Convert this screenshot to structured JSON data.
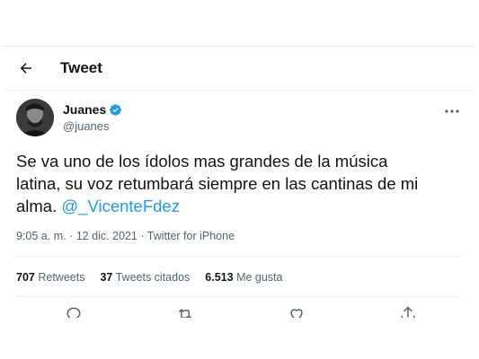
{
  "header": {
    "title": "Tweet",
    "back_icon": "arrow-left-icon"
  },
  "author": {
    "name": "Juanes",
    "handle": "@juanes",
    "verified": true,
    "verified_color": "#1d9bf0"
  },
  "tweet": {
    "text_line_1": "Se va uno de los ídolos mas grandes de la música",
    "text_line_2": "latina, su voz retumbará siempre en las cantinas de mi",
    "text_line_3_prefix": "alma.",
    "mention": "@_VicenteFdez",
    "time": "9:05 a. m.",
    "separator": "·",
    "date": "12 dic. 2021",
    "source": "Twitter for iPhone"
  },
  "stats": {
    "retweets_count": "707",
    "retweets_label": "Retweets",
    "quotes_count": "37",
    "quotes_label": "Tweets citados",
    "likes_count": "6.513",
    "likes_label": "Me gusta"
  },
  "colors": {
    "accent": "#1d9bf0",
    "text": "#0f1419",
    "secondary": "#536471"
  }
}
